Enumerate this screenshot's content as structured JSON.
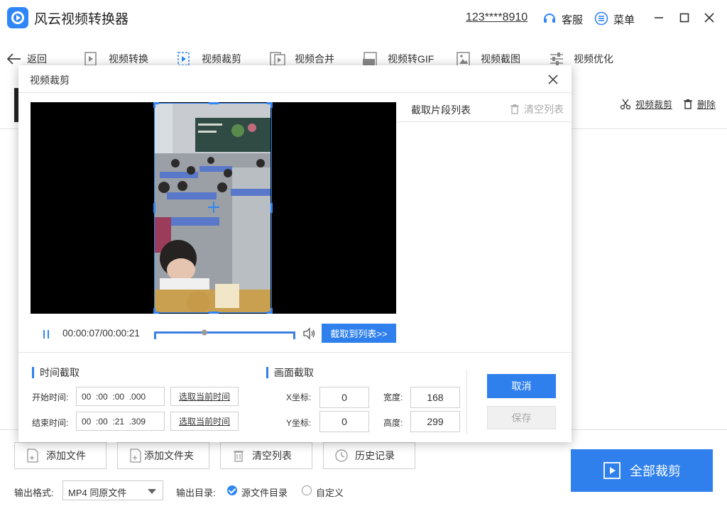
{
  "app": {
    "title": "风云视频转换器",
    "account": "123****8910",
    "service_label": "客服",
    "menu_label": "菜单"
  },
  "toolbar": {
    "back_label": "返回",
    "tools": [
      {
        "label": "视频转换",
        "icon": "video-convert-icon"
      },
      {
        "label": "视频裁剪",
        "icon": "video-crop-icon"
      },
      {
        "label": "视频合并",
        "icon": "video-merge-icon"
      },
      {
        "label": "视频转GIF",
        "icon": "gif-icon"
      },
      {
        "label": "视频截图",
        "icon": "screenshot-icon"
      },
      {
        "label": "视频优化",
        "icon": "optimize-icon"
      }
    ]
  },
  "file_row": {
    "crop_link": "视频裁剪",
    "delete_link": "删除"
  },
  "dialog": {
    "title": "视频裁剪",
    "clip_list_title": "截取片段列表",
    "clear_list": "清空列表",
    "time_readout": "00:00:07/00:00:21",
    "progress": 0.35,
    "to_list_button": "截取到列表>>",
    "time_section_title": "时间截取",
    "start_label": "开始时间:",
    "start_time": "00  :00  :00  .000",
    "end_label": "结束时间:",
    "end_time": "00  :00  :21  .309",
    "use_current_time": "选取当前时间",
    "frame_section_title": "画面截取",
    "x_label": "X坐标:",
    "x_value": "0",
    "y_label": "Y坐标:",
    "y_value": "0",
    "width_label": "宽度:",
    "width_value": "168",
    "height_label": "高度:",
    "height_value": "299",
    "cancel_button": "取消",
    "save_button": "保存"
  },
  "bottom": {
    "add_file": "添加文件",
    "add_folder": "添加文件夹",
    "clear_list": "清空列表",
    "history": "历史记录",
    "output_format_label": "输出格式:",
    "output_format_value": "MP4 同原文件",
    "output_dir_label": "输出目录:",
    "source_dir_option": "源文件目录",
    "custom_option": "自定义",
    "crop_all_button": "全部裁剪"
  },
  "colors": {
    "accent": "#2f80ed",
    "logo": "#2f86f6"
  }
}
